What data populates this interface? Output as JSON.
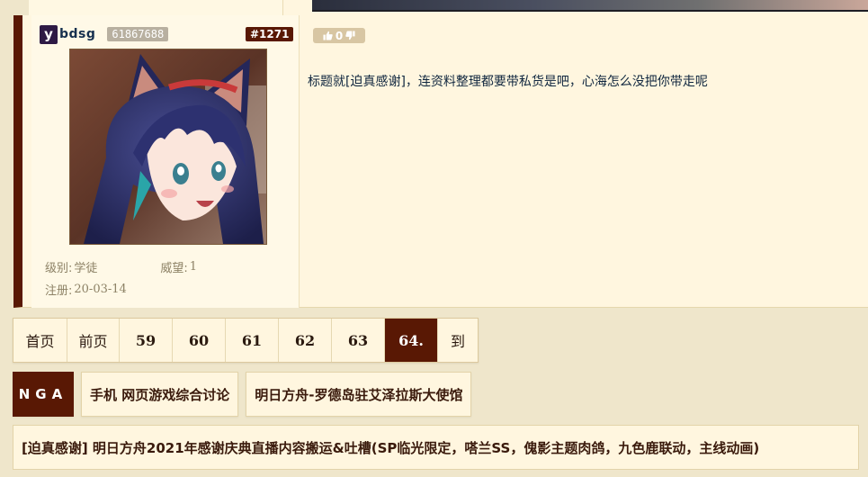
{
  "post": {
    "user": {
      "initial": "y",
      "name": "bdsg",
      "uid": "61867688",
      "level_label": "级别:",
      "level_value": "学徒",
      "prestige_label": "威望:",
      "prestige_value": "1",
      "register_label": "注册:",
      "register_value": "20-03-14"
    },
    "floor": "#1271",
    "vote_count": "0",
    "content": "标题就[迫真感谢]，连资料整理都要带私货是吧，心海怎么没把你带走呢"
  },
  "pagination": [
    {
      "label": "首页",
      "active": false
    },
    {
      "label": "前页",
      "active": false
    },
    {
      "label": "59",
      "active": false
    },
    {
      "label": "60",
      "active": false
    },
    {
      "label": "61",
      "active": false
    },
    {
      "label": "62",
      "active": false
    },
    {
      "label": "63",
      "active": false
    },
    {
      "label": "64.",
      "active": true
    },
    {
      "label": "到",
      "active": false
    }
  ],
  "breadcrumb": {
    "brand": "NGA",
    "items": [
      "手机 网页游戏综合讨论",
      "明日方舟-罗德岛驻艾泽拉斯大使馆"
    ]
  },
  "thread_title": "[迫真感谢] 明日方舟2021年感谢庆典直播内容搬运&吐槽(SP临光限定，嗒兰SS，傀影主题肉鸽，九色鹿联动，主线动画)",
  "colors": {
    "accent": "#591804",
    "page_bg": "#efe6cb",
    "post_bg": "#fff6df",
    "text": "#10273f"
  },
  "icons": {
    "vote": [
      "thumb-up-icon",
      "thumb-down-icon"
    ]
  }
}
